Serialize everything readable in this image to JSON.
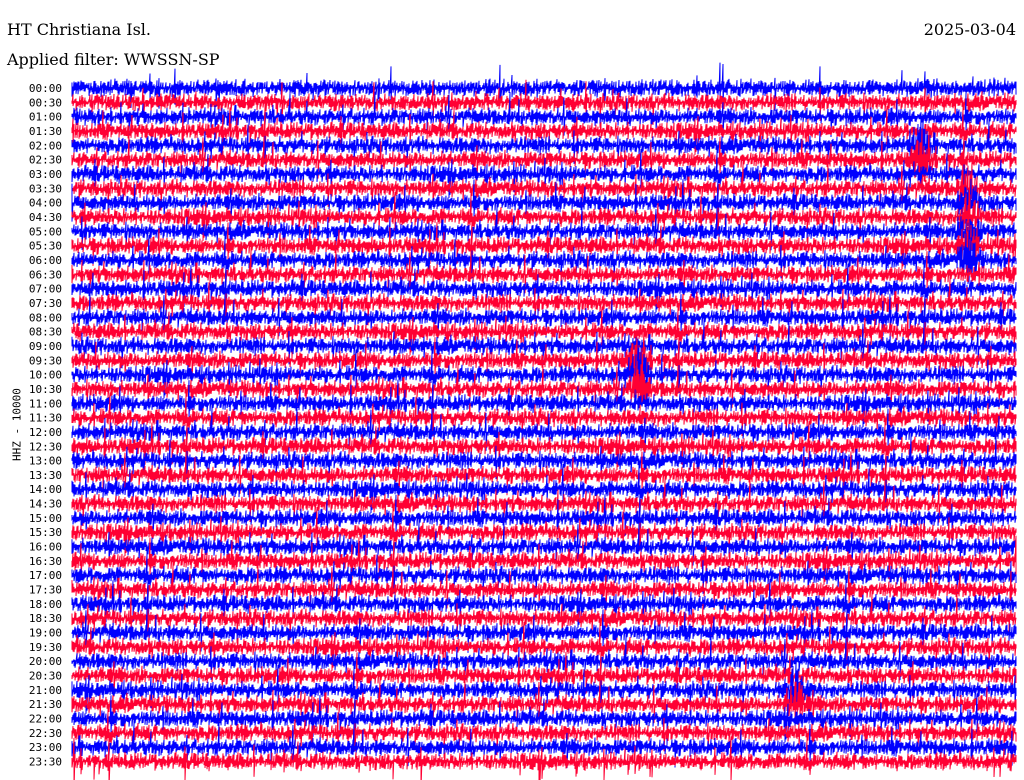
{
  "header": {
    "station": "HT Christiana Isl.",
    "date": "2025-03-04",
    "filter": "Applied filter: WWSSN-SP"
  },
  "chart_data": {
    "type": "line",
    "subtype": "helicorder",
    "title": "HT Christiana Isl.",
    "ylabel": "HHZ - 10000",
    "xlabel": "",
    "row_labels": [
      "00:00",
      "00:30",
      "01:00",
      "01:30",
      "02:00",
      "02:30",
      "03:00",
      "03:30",
      "04:00",
      "04:30",
      "05:00",
      "05:30",
      "06:00",
      "06:30",
      "07:00",
      "07:30",
      "08:00",
      "08:30",
      "09:00",
      "09:30",
      "10:00",
      "10:30",
      "11:00",
      "11:30",
      "12:00",
      "12:30",
      "13:00",
      "13:30",
      "14:00",
      "14:30",
      "15:00",
      "15:30",
      "16:00",
      "16:30",
      "17:00",
      "17:30",
      "18:00",
      "18:30",
      "19:00",
      "19:30",
      "20:00",
      "20:30",
      "21:00",
      "21:30",
      "22:00",
      "22:30",
      "23:00",
      "23:30"
    ],
    "minutes_per_row": 30,
    "series_colors": [
      "#0000ff",
      "#ff0033"
    ],
    "events": [
      {
        "row_start": "02:00",
        "row_end": "02:30",
        "minute": 27
      },
      {
        "row_start": "03:30",
        "row_end": "06:00",
        "minute": 28.5
      },
      {
        "row_start": "09:30",
        "row_end": "10:30",
        "minute": 18
      },
      {
        "row_start": "21:00",
        "row_end": "21:30",
        "minute": 23
      }
    ]
  }
}
